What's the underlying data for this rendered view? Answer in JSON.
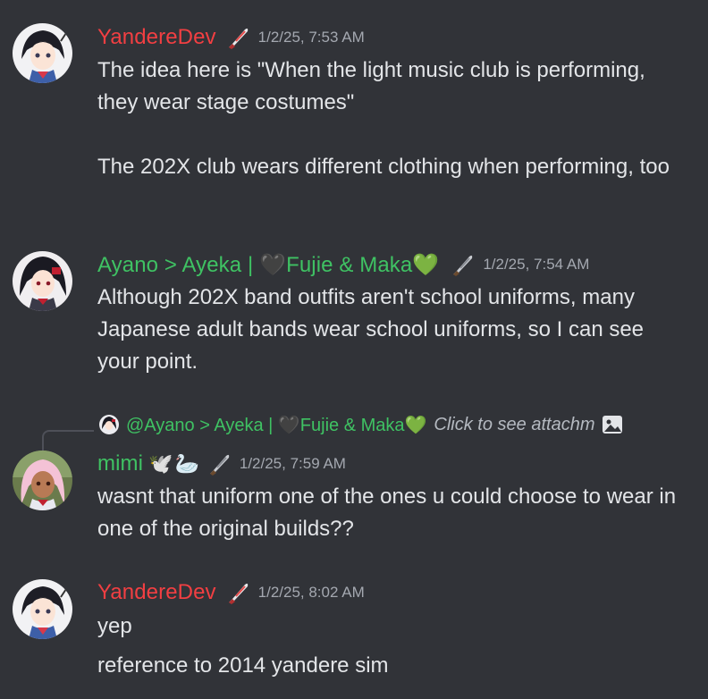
{
  "messages": [
    {
      "username": "YandereDev",
      "name_color": "#f23f42",
      "badge_icon": "knife-icon",
      "timestamp": "1/2/25, 7:53 AM",
      "paragraphs": [
        "The idea here is \"When the light music club is performing, they wear stage costumes\"",
        "The 202X club wears different clothing when performing, too"
      ]
    },
    {
      "username_prefix": "Ayano > Ayeka | ",
      "username_heart1": "🖤",
      "username_mid": "Fujie & Maka",
      "username_heart2": "💚",
      "name_color": "#3fc263",
      "badge_icon": "knife-icon",
      "timestamp": "1/2/25, 7:54 AM",
      "paragraphs": [
        "Although 202X band outfits aren't school uniforms, many Japanese adult bands wear school uniforms, so I can see your point."
      ]
    },
    {
      "reply": {
        "prefix": "@Ayano > Ayeka | ",
        "heart1": "🖤",
        "mid": "Fujie & Maka",
        "heart2": "💚",
        "click_text": "Click to see attachment",
        "icon": "image-icon"
      },
      "username": "mimi",
      "name_color": "#3fc263",
      "emojis": [
        "🕊️",
        "🦢"
      ],
      "badge_icon": "knife-icon",
      "timestamp": "1/2/25, 7:59 AM",
      "paragraphs": [
        "wasnt that uniform one of the ones u could choose to wear in one of the original builds??"
      ]
    },
    {
      "username": "YandereDev",
      "name_color": "#f23f42",
      "badge_icon": "knife-icon",
      "timestamp": "1/2/25, 8:02 AM",
      "paragraphs": [
        "yep",
        "reference to 2014 yandere sim"
      ]
    }
  ]
}
